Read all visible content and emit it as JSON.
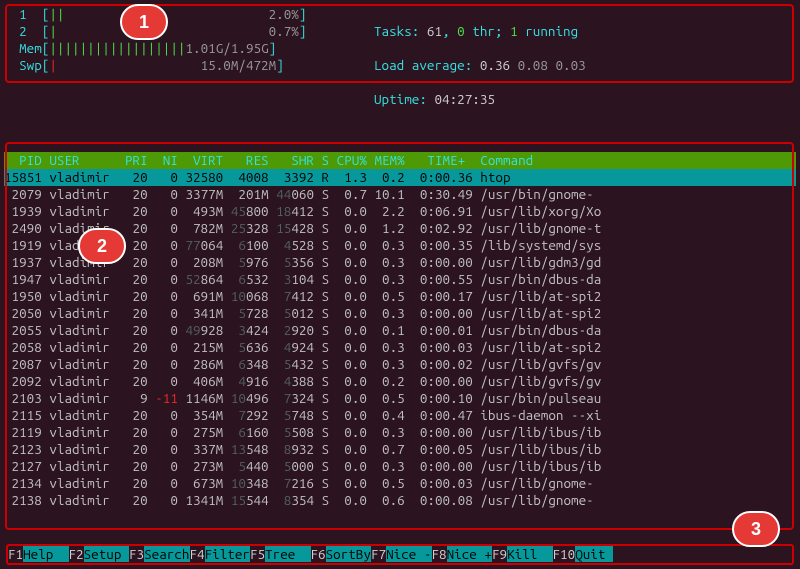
{
  "meters": {
    "cpu1_label": "1",
    "cpu1_pct": "2.0%",
    "cpu2_label": "2",
    "cpu2_pct": "0.7%",
    "mem_label": "Mem",
    "mem_val": "1.01G/1.95G",
    "swp_label": "Swp",
    "swp_val": "15.0M/472M"
  },
  "info": {
    "tasks_label": "Tasks: ",
    "tasks": "61",
    "thr": "0",
    "thr_txt": " thr; ",
    "running": "1",
    "running_txt": " running",
    "load_label": "Load average: ",
    "load1": "0.36",
    "load2": "0.08",
    "load3": "0.03",
    "uptime_label": "Uptime: ",
    "uptime": "04:27:35"
  },
  "columns": "  PID USER      PRI  NI  VIRT   RES   SHR S CPU% MEM%   TIME+  Command",
  "procs": [
    {
      "pid": "15851",
      "user": "vladimir",
      "pri": "20",
      "ni": "0",
      "virt": "32580",
      "res": "4008",
      "shr": "3392",
      "s": "R",
      "cpu": "1.3",
      "mem": "0.2",
      "time": "0:00.36",
      "cmd": "htop",
      "sel": true
    },
    {
      "pid": "2079",
      "user": "vladimir",
      "pri": "20",
      "ni": "0",
      "virt": "3377M",
      "res": "201M",
      "shr": "44060",
      "s": "S",
      "cpu": "0.7",
      "mem": "10.1",
      "time": "0:30.49",
      "cmd": "/usr/bin/gnome-"
    },
    {
      "pid": "1939",
      "user": "vladimir",
      "pri": "20",
      "ni": "0",
      "virt": "493M",
      "res": "45800",
      "shr": "18412",
      "s": "S",
      "cpu": "0.0",
      "mem": "2.2",
      "time": "0:06.91",
      "cmd": "/usr/lib/xorg/Xo"
    },
    {
      "pid": "2490",
      "user": "vladimir",
      "pri": "20",
      "ni": "0",
      "virt": "782M",
      "res": "25328",
      "shr": "15428",
      "s": "S",
      "cpu": "0.0",
      "mem": "1.2",
      "time": "0:02.92",
      "cmd": "/usr/lib/gnome-t"
    },
    {
      "pid": "1919",
      "user": "vladimir",
      "pri": "20",
      "ni": "0",
      "virt": "77064",
      "res": "6100",
      "shr": "4528",
      "s": "S",
      "cpu": "0.0",
      "mem": "0.3",
      "time": "0:00.35",
      "cmd": "/lib/systemd/sys"
    },
    {
      "pid": "1937",
      "user": "vladimir",
      "pri": "20",
      "ni": "0",
      "virt": "208M",
      "res": "5976",
      "shr": "5356",
      "s": "S",
      "cpu": "0.0",
      "mem": "0.3",
      "time": "0:00.00",
      "cmd": "/usr/lib/gdm3/gd"
    },
    {
      "pid": "1947",
      "user": "vladimir",
      "pri": "20",
      "ni": "0",
      "virt": "52864",
      "res": "6532",
      "shr": "3104",
      "s": "S",
      "cpu": "0.0",
      "mem": "0.3",
      "time": "0:00.55",
      "cmd": "/usr/bin/dbus-da"
    },
    {
      "pid": "1950",
      "user": "vladimir",
      "pri": "20",
      "ni": "0",
      "virt": "691M",
      "res": "10068",
      "shr": "7412",
      "s": "S",
      "cpu": "0.0",
      "mem": "0.5",
      "time": "0:00.17",
      "cmd": "/usr/lib/at-spi2"
    },
    {
      "pid": "2050",
      "user": "vladimir",
      "pri": "20",
      "ni": "0",
      "virt": "341M",
      "res": "5728",
      "shr": "5012",
      "s": "S",
      "cpu": "0.0",
      "mem": "0.3",
      "time": "0:00.00",
      "cmd": "/usr/lib/at-spi2"
    },
    {
      "pid": "2055",
      "user": "vladimir",
      "pri": "20",
      "ni": "0",
      "virt": "49928",
      "res": "3424",
      "shr": "2920",
      "s": "S",
      "cpu": "0.0",
      "mem": "0.1",
      "time": "0:00.01",
      "cmd": "/usr/bin/dbus-da"
    },
    {
      "pid": "2058",
      "user": "vladimir",
      "pri": "20",
      "ni": "0",
      "virt": "215M",
      "res": "5636",
      "shr": "4924",
      "s": "S",
      "cpu": "0.0",
      "mem": "0.3",
      "time": "0:00.03",
      "cmd": "/usr/lib/at-spi2"
    },
    {
      "pid": "2087",
      "user": "vladimir",
      "pri": "20",
      "ni": "0",
      "virt": "286M",
      "res": "6348",
      "shr": "5432",
      "s": "S",
      "cpu": "0.0",
      "mem": "0.3",
      "time": "0:00.02",
      "cmd": "/usr/lib/gvfs/gv"
    },
    {
      "pid": "2092",
      "user": "vladimir",
      "pri": "20",
      "ni": "0",
      "virt": "406M",
      "res": "4916",
      "shr": "4388",
      "s": "S",
      "cpu": "0.0",
      "mem": "0.2",
      "time": "0:00.00",
      "cmd": "/usr/lib/gvfs/gv"
    },
    {
      "pid": "2103",
      "user": "vladimir",
      "pri": "9",
      "ni": "-11",
      "virt": "1146M",
      "res": "10496",
      "shr": "7324",
      "s": "S",
      "cpu": "0.0",
      "mem": "0.5",
      "time": "0:00.10",
      "cmd": "/usr/bin/pulseau"
    },
    {
      "pid": "2115",
      "user": "vladimir",
      "pri": "20",
      "ni": "0",
      "virt": "354M",
      "res": "7292",
      "shr": "5748",
      "s": "S",
      "cpu": "0.0",
      "mem": "0.4",
      "time": "0:00.47",
      "cmd": "ibus-daemon --xi"
    },
    {
      "pid": "2119",
      "user": "vladimir",
      "pri": "20",
      "ni": "0",
      "virt": "275M",
      "res": "6160",
      "shr": "5508",
      "s": "S",
      "cpu": "0.0",
      "mem": "0.3",
      "time": "0:00.00",
      "cmd": "/usr/lib/ibus/ib"
    },
    {
      "pid": "2123",
      "user": "vladimir",
      "pri": "20",
      "ni": "0",
      "virt": "337M",
      "res": "13548",
      "shr": "8932",
      "s": "S",
      "cpu": "0.0",
      "mem": "0.7",
      "time": "0:00.05",
      "cmd": "/usr/lib/ibus/ib"
    },
    {
      "pid": "2127",
      "user": "vladimir",
      "pri": "20",
      "ni": "0",
      "virt": "273M",
      "res": "5440",
      "shr": "5000",
      "s": "S",
      "cpu": "0.0",
      "mem": "0.3",
      "time": "0:00.00",
      "cmd": "/usr/lib/ibus/ib"
    },
    {
      "pid": "2134",
      "user": "vladimir",
      "pri": "20",
      "ni": "0",
      "virt": "673M",
      "res": "10348",
      "shr": "7216",
      "s": "S",
      "cpu": "0.0",
      "mem": "0.5",
      "time": "0:00.03",
      "cmd": "/usr/lib/gnome-"
    },
    {
      "pid": "2138",
      "user": "vladimir",
      "pri": "20",
      "ni": "0",
      "virt": "1341M",
      "res": "15544",
      "shr": "8354",
      "s": "S",
      "cpu": "0.0",
      "mem": "0.6",
      "time": "0:00.08",
      "cmd": "/usr/lib/gnome-"
    }
  ],
  "fkeys": [
    {
      "k": "F1",
      "l": "Help  "
    },
    {
      "k": "F2",
      "l": "Setup "
    },
    {
      "k": "F3",
      "l": "Search"
    },
    {
      "k": "F4",
      "l": "Filter"
    },
    {
      "k": "F5",
      "l": "Tree  "
    },
    {
      "k": "F6",
      "l": "SortBy"
    },
    {
      "k": "F7",
      "l": "Nice -"
    },
    {
      "k": "F8",
      "l": "Nice +"
    },
    {
      "k": "F9",
      "l": "Kill  "
    },
    {
      "k": "F10",
      "l": "Quit "
    }
  ],
  "annotations": {
    "a1": "1",
    "a2": "2",
    "a3": "3"
  }
}
